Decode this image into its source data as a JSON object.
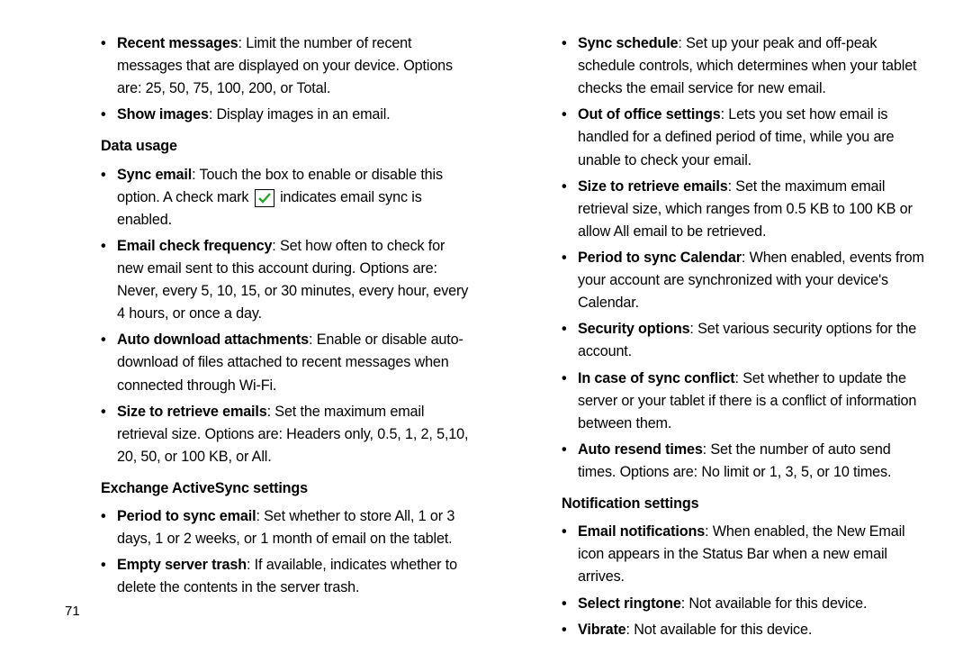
{
  "pageNumber": "71",
  "left": {
    "items_top": [
      {
        "bold": "Recent messages",
        "text": ": Limit the number of recent messages that are displayed on your device. Options are: 25, 50, 75, 100, 200, or Total."
      },
      {
        "bold": "Show images",
        "text": ": Display images in an email."
      }
    ],
    "heading1": "Data usage",
    "items_data": [
      {
        "bold": "Sync email",
        "pre": ": Touch the box to enable or disable this option. A check mark ",
        "post": " indicates email sync is enabled."
      },
      {
        "bold": "Email check frequency",
        "text": ": Set how often to check for new email sent to this account during. Options are: Never, every 5, 10, 15, or 30 minutes, every hour, every 4 hours, or once a day."
      },
      {
        "bold": "Auto download attachments",
        "text": ": Enable or disable auto-download of files attached to recent messages when connected through Wi-Fi."
      },
      {
        "bold": "Size to retrieve emails",
        "text": ": Set the maximum email retrieval size. Options are: Headers only, 0.5, 1, 2, 5,10, 20, 50, or 100 KB, or All."
      }
    ],
    "heading2": "Exchange ActiveSync settings",
    "items_exchange": [
      {
        "bold": "Period to sync email",
        "text": ": Set whether to store All, 1 or 3 days, 1 or 2 weeks, or 1 month of email on the tablet."
      },
      {
        "bold": "Empty server trash",
        "text": ": If available, indicates whether to delete the contents in the server trash."
      }
    ]
  },
  "right": {
    "items_top": [
      {
        "bold": "Sync schedule",
        "text": ": Set up your peak and off-peak schedule controls, which determines when your tablet checks the email service for new email."
      },
      {
        "bold": "Out of office settings",
        "text": ": Lets you set how email is handled for a defined period of time, while you are unable to check your email."
      },
      {
        "bold": "Size to retrieve emails",
        "text": ": Set the maximum email retrieval size, which ranges from 0.5 KB to 100 KB or allow All email to be retrieved."
      },
      {
        "bold": "Period to sync Calendar",
        "text": ": When enabled, events from your account are synchronized with your device's Calendar."
      },
      {
        "bold": "Security options",
        "text": ": Set various security options for the account."
      },
      {
        "bold": "In case of sync conflict",
        "text": ": Set whether to update the server or your tablet if there is a conflict of information between them."
      },
      {
        "bold": "Auto resend times",
        "text": ": Set the number of auto send times. Options are: No limit or 1, 3, 5, or 10 times."
      }
    ],
    "heading1": "Notification settings",
    "items_notif": [
      {
        "bold": "Email notifications",
        "text": ": When enabled, the New Email icon appears in the Status Bar when a new email arrives."
      },
      {
        "bold": "Select ringtone",
        "text": ": Not available for this device."
      },
      {
        "bold": "Vibrate",
        "text": ": Not available for this device."
      }
    ]
  }
}
